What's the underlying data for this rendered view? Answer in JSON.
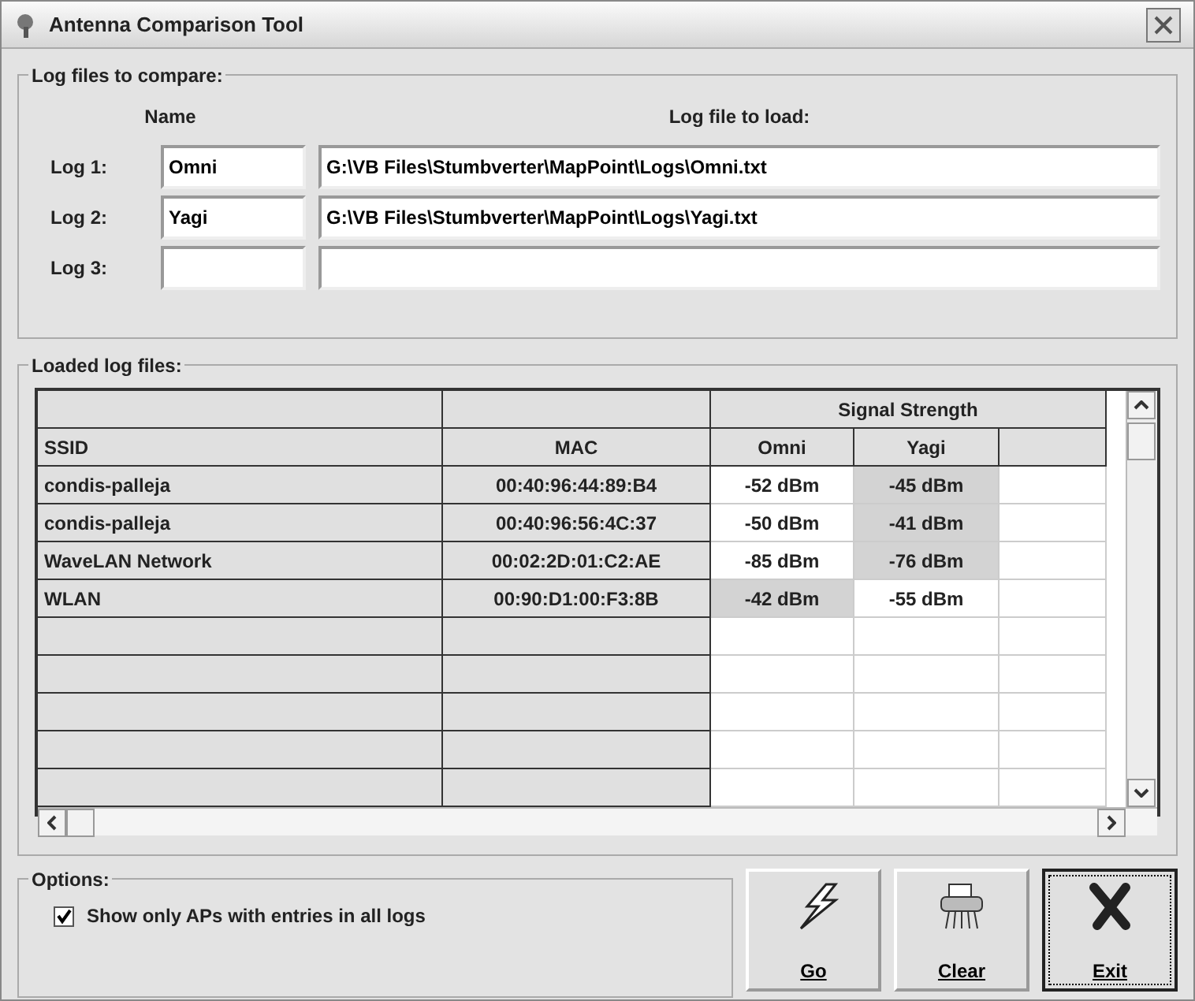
{
  "window": {
    "title": "Antenna Comparison Tool"
  },
  "log_files": {
    "legend": "Log files to compare:",
    "name_heading": "Name",
    "file_heading": "Log file to load:",
    "logs": [
      {
        "label": "Log 1:",
        "name": "Omni",
        "file": "G:\\VB Files\\Stumbverter\\MapPoint\\Logs\\Omni.txt"
      },
      {
        "label": "Log 2:",
        "name": "Yagi",
        "file": "G:\\VB Files\\Stumbverter\\MapPoint\\Logs\\Yagi.txt"
      },
      {
        "label": "Log 3:"
      }
    ]
  },
  "loaded": {
    "legend": "Loaded log files:",
    "group_heading": "Signal Strength",
    "columns": [
      "SSID",
      "MAC",
      "Omni",
      "Yagi"
    ],
    "rows": [
      {
        "ssid": "condis-palleja",
        "mac": "00:40:96:44:89:B4",
        "signals": [
          {
            "text": "-52 dBm",
            "best": false
          },
          {
            "text": "-45 dBm",
            "best": true
          }
        ]
      },
      {
        "ssid": "condis-palleja",
        "mac": "00:40:96:56:4C:37",
        "signals": [
          {
            "text": "-50 dBm",
            "best": false
          },
          {
            "text": "-41 dBm",
            "best": true
          }
        ]
      },
      {
        "ssid": "WaveLAN Network",
        "mac": "00:02:2D:01:C2:AE",
        "signals": [
          {
            "text": "-85 dBm",
            "best": false
          },
          {
            "text": "-76 dBm",
            "best": true
          }
        ]
      },
      {
        "ssid": "WLAN",
        "mac": "00:90:D1:00:F3:8B",
        "signals": [
          {
            "text": "-42 dBm",
            "best": true
          },
          {
            "text": "-55 dBm",
            "best": false
          }
        ]
      }
    ]
  },
  "options": {
    "legend": "Options:",
    "checkbox": {
      "label": "Show only APs with entries in all logs",
      "checked": true
    }
  },
  "buttons": [
    {
      "kind": "go",
      "label": "Go"
    },
    {
      "kind": "clear",
      "label": "Clear"
    },
    {
      "kind": "exit",
      "label": "Exit",
      "focused": true
    }
  ]
}
